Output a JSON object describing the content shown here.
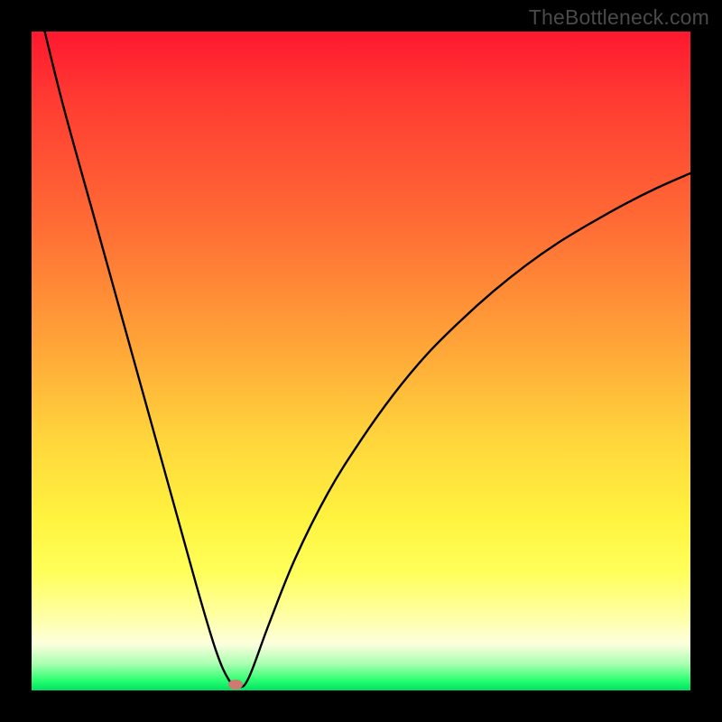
{
  "watermark": "TheBottleneck.com",
  "chart_data": {
    "type": "line",
    "title": "",
    "xlabel": "",
    "ylabel": "",
    "xlim": [
      0,
      100
    ],
    "ylim": [
      0,
      100
    ],
    "grid": false,
    "legend": false,
    "series": [
      {
        "name": "bottleneck-curve",
        "x": [
          2,
          5,
          10,
          15,
          20,
          25,
          28,
          30,
          31.5,
          33,
          36,
          40,
          45,
          50,
          55,
          60,
          65,
          70,
          75,
          80,
          85,
          90,
          95,
          100
        ],
        "y": [
          100,
          88,
          70,
          52,
          34,
          16,
          6,
          1.5,
          0.5,
          2,
          10,
          20,
          30,
          38,
          45,
          51,
          56,
          60.5,
          64.5,
          68,
          71,
          73.8,
          76.3,
          78.5
        ]
      }
    ],
    "marker": {
      "x": 31,
      "y": 1,
      "color": "#ce7a72"
    },
    "gradient_stops": [
      {
        "pos": 0,
        "color": "#ff182f"
      },
      {
        "pos": 10,
        "color": "#ff3a32"
      },
      {
        "pos": 30,
        "color": "#ff6e35"
      },
      {
        "pos": 48,
        "color": "#ffa638"
      },
      {
        "pos": 62,
        "color": "#ffd63c"
      },
      {
        "pos": 74,
        "color": "#fff33f"
      },
      {
        "pos": 82,
        "color": "#ffff5a"
      },
      {
        "pos": 89,
        "color": "#ffffa8"
      },
      {
        "pos": 93,
        "color": "#fcffdd"
      },
      {
        "pos": 96,
        "color": "#a8ffb0"
      },
      {
        "pos": 98.5,
        "color": "#29ff70"
      },
      {
        "pos": 100,
        "color": "#00e060"
      }
    ]
  }
}
